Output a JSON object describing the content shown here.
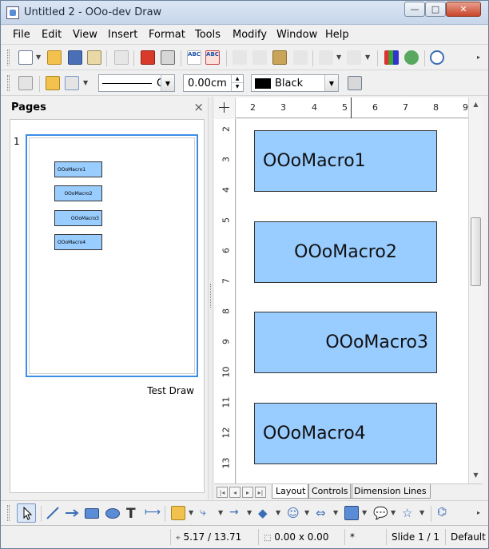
{
  "window": {
    "title": "Untitled 2 - OOo-dev Draw",
    "controls": {
      "minimize": "—",
      "maximize": "□",
      "close": "✕"
    }
  },
  "menu": [
    "File",
    "Edit",
    "View",
    "Insert",
    "Format",
    "Tools",
    "Modify",
    "Window",
    "Help"
  ],
  "toolbar2": {
    "line_style": "C",
    "line_width": "0.00cm",
    "area_color": "Black"
  },
  "pages_pane": {
    "title": "Pages",
    "close": "×",
    "pages": [
      {
        "number": "1",
        "name": "Test Draw",
        "shapes": [
          "OOoMacro1",
          "OOoMacro2",
          "OOoMacro3",
          "OOoMacro4"
        ]
      }
    ]
  },
  "ruler": {
    "horizontal": [
      "2",
      "3",
      "4",
      "5",
      "6",
      "7",
      "8",
      "9"
    ],
    "vertical": [
      "2",
      "3",
      "4",
      "5",
      "6",
      "7",
      "8",
      "9",
      "10",
      "11",
      "12",
      "13"
    ]
  },
  "canvas": {
    "shapes": [
      {
        "label": "OOoMacro1",
        "align": "left"
      },
      {
        "label": "OOoMacro2",
        "align": "center"
      },
      {
        "label": "OOoMacro3",
        "align": "right"
      },
      {
        "label": "OOoMacro4",
        "align": "left"
      }
    ],
    "shape_fill": "#99ccff"
  },
  "tabs": [
    "Layout",
    "Controls",
    "Dimension Lines"
  ],
  "tab_nav": [
    "|◂",
    "◂",
    "▸",
    "▸|"
  ],
  "status": {
    "position": "5.17 / 13.71",
    "size": "0.00 x 0.00",
    "modified": "*",
    "slide": "Slide 1 / 1",
    "layout": "Default"
  },
  "colors": {
    "accent": "#3a8ee6",
    "shape": "#99ccff"
  }
}
